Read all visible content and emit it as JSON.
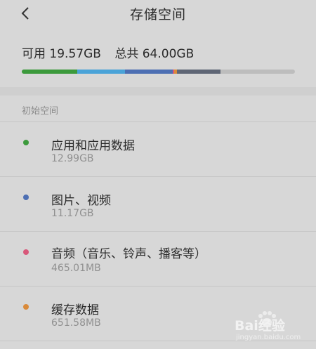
{
  "header": {
    "title": "存储空间"
  },
  "summary": {
    "available": "可用 19.57GB",
    "total": "总共 64.00GB"
  },
  "usage_bar": {
    "segments": [
      {
        "name": "apps",
        "color": "#3c9a3c",
        "fraction": 0.2025
      },
      {
        "name": "images-videos",
        "color": "#4aa3d8",
        "fraction": 0.1745
      },
      {
        "name": "images-videos-2",
        "color": "#4d6fb3",
        "fraction": 0.1745
      },
      {
        "name": "audio",
        "color": "#d8587a",
        "fraction": 0.0073
      },
      {
        "name": "cache",
        "color": "#d98a3a",
        "fraction": 0.0102
      },
      {
        "name": "other",
        "color": "#5f6675",
        "fraction": 0.1595
      }
    ],
    "track_color": "#bdbdbd"
  },
  "section": {
    "label": "初始空间"
  },
  "items": [
    {
      "name": "应用和应用数据",
      "size": "12.99GB",
      "color": "#3c9a3c"
    },
    {
      "name": "图片、视频",
      "size": "11.17GB",
      "color": "#4d6fb3"
    },
    {
      "name": "音频（音乐、铃声、播客等）",
      "size": "465.01MB",
      "color": "#d8587a"
    },
    {
      "name": "缓存数据",
      "size": "651.58MB",
      "color": "#d98a3a"
    }
  ],
  "watermark": {
    "main": "Bai经验",
    "sub": "jingyan.baidu.com"
  }
}
